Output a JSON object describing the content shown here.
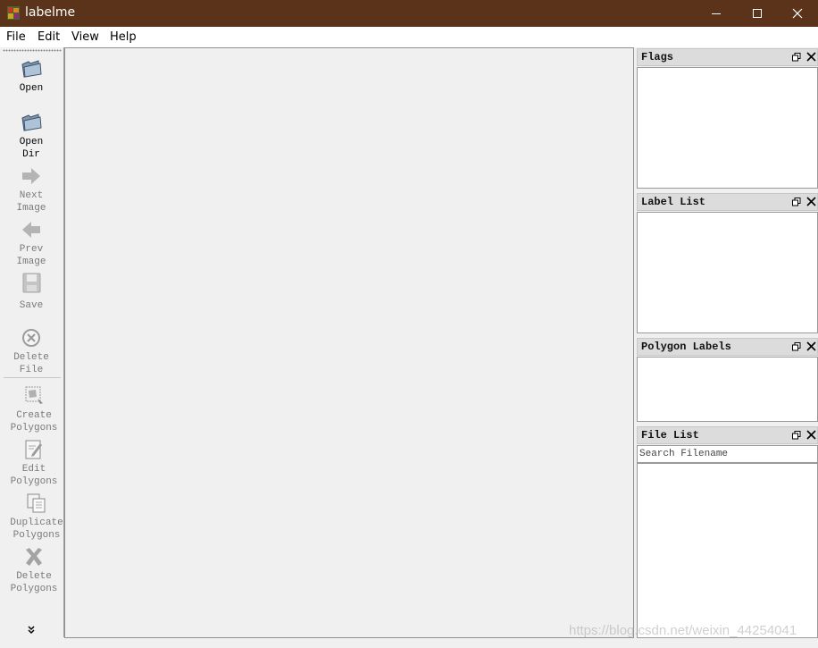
{
  "window": {
    "title": "labelme",
    "titlebar_color": "#5a331a",
    "controls": [
      "minimize-icon",
      "maximize-icon",
      "close-icon"
    ]
  },
  "menu": {
    "items": [
      "File",
      "Edit",
      "View",
      "Help"
    ]
  },
  "toolbar": {
    "tools": [
      {
        "label": "Open",
        "icon": "folder-open-icon",
        "enabled": true
      },
      {
        "label": "Open\nDir",
        "icon": "folder-open-dir-icon",
        "enabled": true
      },
      {
        "label": "Next\nImage",
        "icon": "arrow-right-icon",
        "enabled": false
      },
      {
        "label": "Prev\nImage",
        "icon": "arrow-left-icon",
        "enabled": false
      },
      {
        "label": "Save",
        "icon": "floppy-disk-icon",
        "enabled": false
      },
      {
        "label": "Delete\nFile",
        "icon": "delete-circle-icon",
        "enabled": false
      },
      {
        "label": "Create\nPolygons",
        "icon": "create-polygon-icon",
        "enabled": false
      },
      {
        "label": "Edit\nPolygons",
        "icon": "edit-polygon-icon",
        "enabled": false
      },
      {
        "label": "Duplicate\nPolygons",
        "icon": "duplicate-polygon-icon",
        "enabled": false
      },
      {
        "label": "Delete\nPolygons",
        "icon": "delete-polygon-icon",
        "enabled": false
      }
    ],
    "overflow_icon": "chevron-double-down-icon"
  },
  "docks": {
    "flags": {
      "title": "Flags"
    },
    "label_list": {
      "title": "Label List"
    },
    "polygon_labels": {
      "title": "Polygon Labels"
    },
    "file_list": {
      "title": "File List",
      "search_placeholder": "Search Filename",
      "search_value": ""
    }
  },
  "watermark": "https://blog.csdn.net/weixin_44254041"
}
